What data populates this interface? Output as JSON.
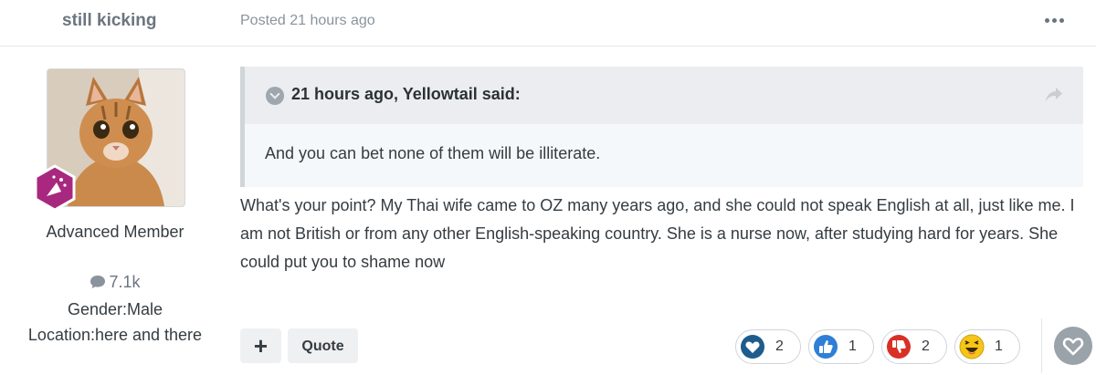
{
  "post": {
    "author": "still kicking",
    "posted": "Posted 21 hours ago",
    "rank": "Advanced Member",
    "post_count": "7.1k",
    "gender": "Gender:Male",
    "location": "Location:here and there",
    "quote": {
      "citation": "21 hours ago, Yellowtail said:",
      "text": "And you can bet none of them will be illiterate."
    },
    "body": "What's your point? My Thai wife came to OZ many years ago, and she could not speak English at all, just like me. I am not British or from any other English-speaking country. She is a nurse now, after studying hard for years. She could put you to shame now"
  },
  "actions": {
    "plus_label": "+",
    "quote_label": "Quote"
  },
  "reactions": [
    {
      "name": "love",
      "count": "2",
      "color": "#1d5c8c"
    },
    {
      "name": "like",
      "count": "1",
      "color": "#2f7fd6"
    },
    {
      "name": "dislike",
      "count": "2",
      "color": "#d93025"
    },
    {
      "name": "haha",
      "count": "1",
      "color": "#f5c518"
    }
  ],
  "icons": {
    "more": "ellipsis-icon",
    "quote_toggle": "chevron-down-icon",
    "share": "share-arrow-icon",
    "comments": "speech-bubble-icon",
    "badge": "rank-badge-icon",
    "favorite": "heart-icon"
  },
  "colors": {
    "quote_border": "#d0d5da",
    "quote_header": "#ebedf0",
    "quote_body": "#f4f8fb"
  }
}
